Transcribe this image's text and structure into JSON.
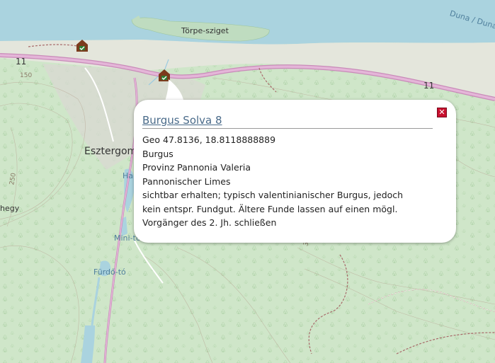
{
  "map": {
    "labels": {
      "island": "Törpe-sziget",
      "river": "Duna / Dunaj",
      "road_11_left": "11",
      "road_11_right": "11",
      "contour_150": "150",
      "contour_250": "250",
      "town": "Esztergom",
      "hill_partial": "hegy",
      "lake_ha": "Ha",
      "mini_to": "Mini-tó",
      "furdo_to": "Fürdő-tó",
      "elev_partial": "3"
    },
    "colors": {
      "water": "#aad3df",
      "forest": "#cfe6c9",
      "road": "#d6a9cc",
      "shore": "#e8e8e0"
    },
    "markers": [
      {
        "name": "castle-marker-1",
        "icon": "fort-icon"
      },
      {
        "name": "castle-marker-2",
        "icon": "fort-icon"
      }
    ]
  },
  "popup": {
    "title": "Burgus Solva 8",
    "close_symbol": "✕",
    "lines": [
      "Geo 47.8136, 18.8118888889",
      "Burgus",
      "Provinz Pannonia Valeria",
      "Pannonischer Limes",
      "sichtbar erhalten; typisch valentinianischer Burgus, jedoch",
      "kein entspr. Fundgut. Ältere Funde lassen auf einen mögl.",
      "Vorgänger des 2. Jh. schließen"
    ]
  }
}
